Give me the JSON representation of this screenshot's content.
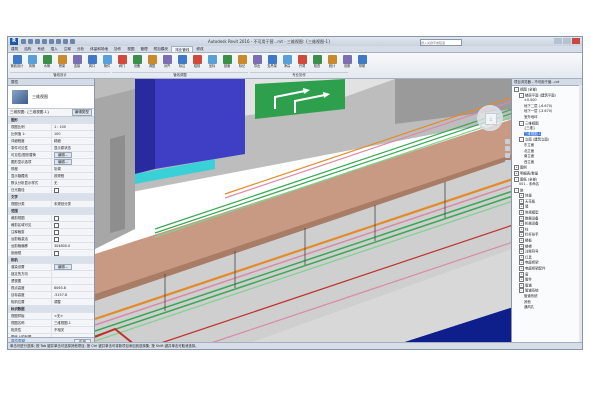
{
  "app": {
    "logo": "R",
    "title": "Autodesk Revit 2016 -      不可用于营...rvt - 三维视图: {三维视图-1}",
    "search_placeholder": "键入关键字或短语"
  },
  "tabs": [
    "建筑",
    "结构",
    "系统",
    "插入",
    "注释",
    "分析",
    "体量和场地",
    "协作",
    "视图",
    "管理",
    "附加模块",
    "鸿业管线",
    "修改"
  ],
  "active_tab": "鸿业管线",
  "ribbon": {
    "tools": [
      {
        "label": "管线设计",
        "color": "#3f79c7"
      },
      {
        "label": "风管",
        "color": "#5aa0d8"
      },
      {
        "label": "水管",
        "color": "#3c8f4a"
      },
      {
        "label": "桥架",
        "color": "#c98a2b"
      },
      {
        "label": "连接",
        "color": "#7b6fb3"
      },
      {
        "label": "风口",
        "color": "#3f79c7"
      },
      {
        "label": "管件",
        "color": "#5aa0d8"
      },
      {
        "label": "阀门",
        "color": "#d04a3b"
      },
      {
        "label": "设备",
        "color": "#3c8f4a"
      },
      {
        "label": "调整",
        "color": "#c98a2b"
      },
      {
        "label": "对齐",
        "color": "#7b6fb3"
      },
      {
        "label": "标注",
        "color": "#3f79c7"
      },
      {
        "label": "碰撞",
        "color": "#d04a3b"
      },
      {
        "label": "坐标",
        "color": "#5aa0d8"
      },
      {
        "label": "剖面",
        "color": "#3c8f4a"
      },
      {
        "label": "标记",
        "color": "#c98a2b"
      },
      {
        "label": "导出",
        "color": "#7b6fb3"
      },
      {
        "label": "支吊架",
        "color": "#3f79c7"
      },
      {
        "label": "净高",
        "color": "#5aa0d8"
      },
      {
        "label": "开洞",
        "color": "#d04a3b"
      },
      {
        "label": "检查",
        "color": "#3c8f4a"
      },
      {
        "label": "统计",
        "color": "#c98a2b"
      },
      {
        "label": "设置",
        "color": "#7b6fb3"
      },
      {
        "label": "帮助",
        "color": "#3f79c7"
      }
    ],
    "groups": [
      "管线设计",
      "管线调整",
      "专业协作"
    ]
  },
  "properties": {
    "header": "属性",
    "type_name": "三维视图",
    "selector_text": "三维视图: {三维视图-1}",
    "edit_type_label": "编辑类型",
    "rows": [
      {
        "k": "图形",
        "v": "",
        "sect": true
      },
      {
        "k": "视图比例",
        "v": "1 : 100"
      },
      {
        "k": "比例值 1:",
        "v": "100"
      },
      {
        "k": "详细程度",
        "v": "精细"
      },
      {
        "k": "零件可见性",
        "v": "显示原状态"
      },
      {
        "k": "可见性/图形替换",
        "v": "编辑...",
        "btn": true
      },
      {
        "k": "图形显示选项",
        "v": "编辑...",
        "btn": true
      },
      {
        "k": "规程",
        "v": "协调"
      },
      {
        "k": "显示隐藏线",
        "v": "按规程"
      },
      {
        "k": "默认分析显示样式",
        "v": "无"
      },
      {
        "k": "日光路径",
        "v": "",
        "chk": true
      },
      {
        "k": "文字",
        "v": "",
        "sect": true
      },
      {
        "k": "视图分类",
        "v": "未规划分类"
      },
      {
        "k": "范围",
        "v": "",
        "sect": true
      },
      {
        "k": "裁剪视图",
        "v": "",
        "chk": true
      },
      {
        "k": "裁剪区域可见",
        "v": "",
        "chk": true
      },
      {
        "k": "注释裁剪",
        "v": "",
        "chk": true
      },
      {
        "k": "远剪裁激活",
        "v": "",
        "chk": true
      },
      {
        "k": "远剪裁偏移",
        "v": "304800.0"
      },
      {
        "k": "剖面框",
        "v": "",
        "chk": true
      },
      {
        "k": "相机",
        "v": "",
        "sect": true
      },
      {
        "k": "渲染设置",
        "v": "编辑...",
        "btn": true
      },
      {
        "k": "锁定的方向",
        "v": ""
      },
      {
        "k": "透视图",
        "v": ""
      },
      {
        "k": "视点高度",
        "v": "8063.8"
      },
      {
        "k": "目标高度",
        "v": "-5157.8"
      },
      {
        "k": "相机位置",
        "v": "调整"
      },
      {
        "k": "标识数据",
        "v": "",
        "sect": true
      },
      {
        "k": "视图样板",
        "v": "<无>"
      },
      {
        "k": "视图名称",
        "v": "三维视图-1"
      },
      {
        "k": "相关性",
        "v": "不相关"
      },
      {
        "k": "图纸上的标题",
        "v": ""
      },
      {
        "k": "阶段化",
        "v": "",
        "sect": true
      },
      {
        "k": "阶段过滤器",
        "v": "全部显示"
      },
      {
        "k": "阶段",
        "v": "新构造"
      }
    ],
    "help_link": "属性帮助",
    "apply_label": "应用"
  },
  "browser": {
    "header": "项目浏览器 - 不可用于营...rvt",
    "items": [
      {
        "t": "视图 (全部)",
        "d": 0,
        "tog": "-"
      },
      {
        "t": "楼层平面 (建筑平面)",
        "d": 1,
        "tog": "-"
      },
      {
        "t": "±0.000",
        "d": 2
      },
      {
        "t": "地下二层 (-6.670)",
        "d": 2
      },
      {
        "t": "地下一层 (-3.670)",
        "d": 2
      },
      {
        "t": "室外地坪",
        "d": 2
      },
      {
        "t": "三维视图",
        "d": 1,
        "tog": "-"
      },
      {
        "t": "{三维}",
        "d": 2
      },
      {
        "t": "三维视图-1",
        "d": 2,
        "sel": true
      },
      {
        "t": "立面 (建筑立面)",
        "d": 1,
        "tog": "-"
      },
      {
        "t": "东立面",
        "d": 2
      },
      {
        "t": "北立面",
        "d": 2
      },
      {
        "t": "南立面",
        "d": 2
      },
      {
        "t": "西立面",
        "d": 2
      },
      {
        "t": "图例",
        "d": 0,
        "tog": "+"
      },
      {
        "t": "明细表/数量",
        "d": 0,
        "tog": "+"
      },
      {
        "t": "图纸 (全部)",
        "d": 0,
        "tog": "-"
      },
      {
        "t": "001 - 未命名",
        "d": 1
      },
      {
        "t": "族",
        "d": 0,
        "tog": "-"
      },
      {
        "t": "体量",
        "d": 1,
        "tog": "+"
      },
      {
        "t": "天花板",
        "d": 1,
        "tog": "+"
      },
      {
        "t": "墙",
        "d": 1,
        "tog": "+"
      },
      {
        "t": "常规模型",
        "d": 1,
        "tog": "+"
      },
      {
        "t": "数据设备",
        "d": 1,
        "tog": "+"
      },
      {
        "t": "机械设备",
        "d": 1,
        "tog": "+"
      },
      {
        "t": "柱",
        "d": 1,
        "tog": "+"
      },
      {
        "t": "栏杆扶手",
        "d": 1,
        "tog": "+"
      },
      {
        "t": "楼板",
        "d": 1,
        "tog": "+"
      },
      {
        "t": "楼梯",
        "d": 1,
        "tog": "+"
      },
      {
        "t": "注释符号",
        "d": 1,
        "tog": "+"
      },
      {
        "t": "灯具",
        "d": 1,
        "tog": "+"
      },
      {
        "t": "电缆桥架",
        "d": 1,
        "tog": "+"
      },
      {
        "t": "电缆桥架配件",
        "d": 1,
        "tog": "+"
      },
      {
        "t": "窗",
        "d": 1,
        "tog": "+"
      },
      {
        "t": "管件",
        "d": 1,
        "tog": "+"
      },
      {
        "t": "管道",
        "d": 1,
        "tog": "+"
      },
      {
        "t": "管道系统",
        "d": 1,
        "tog": "-"
      },
      {
        "t": "管道系统",
        "d": 2
      },
      {
        "t": "其他",
        "d": 2
      },
      {
        "t": "通风孔",
        "d": 2
      }
    ]
  },
  "status_text": "单击可进行选择; 按 Tab 键并单击可选择其他项目; 按 Ctrl 键并单击可将新项目添加到选择集; 按 Shift 键并单击可取消选择。",
  "colors": {
    "beam": "#c99a83",
    "pipe_orange": "#e58a2a",
    "pipe_green": "#39a852",
    "pipe_pink": "#d98aa8",
    "pipe_red": "#c0302a",
    "water": "#0e1f8c",
    "cyan": "#3ad0d8"
  }
}
